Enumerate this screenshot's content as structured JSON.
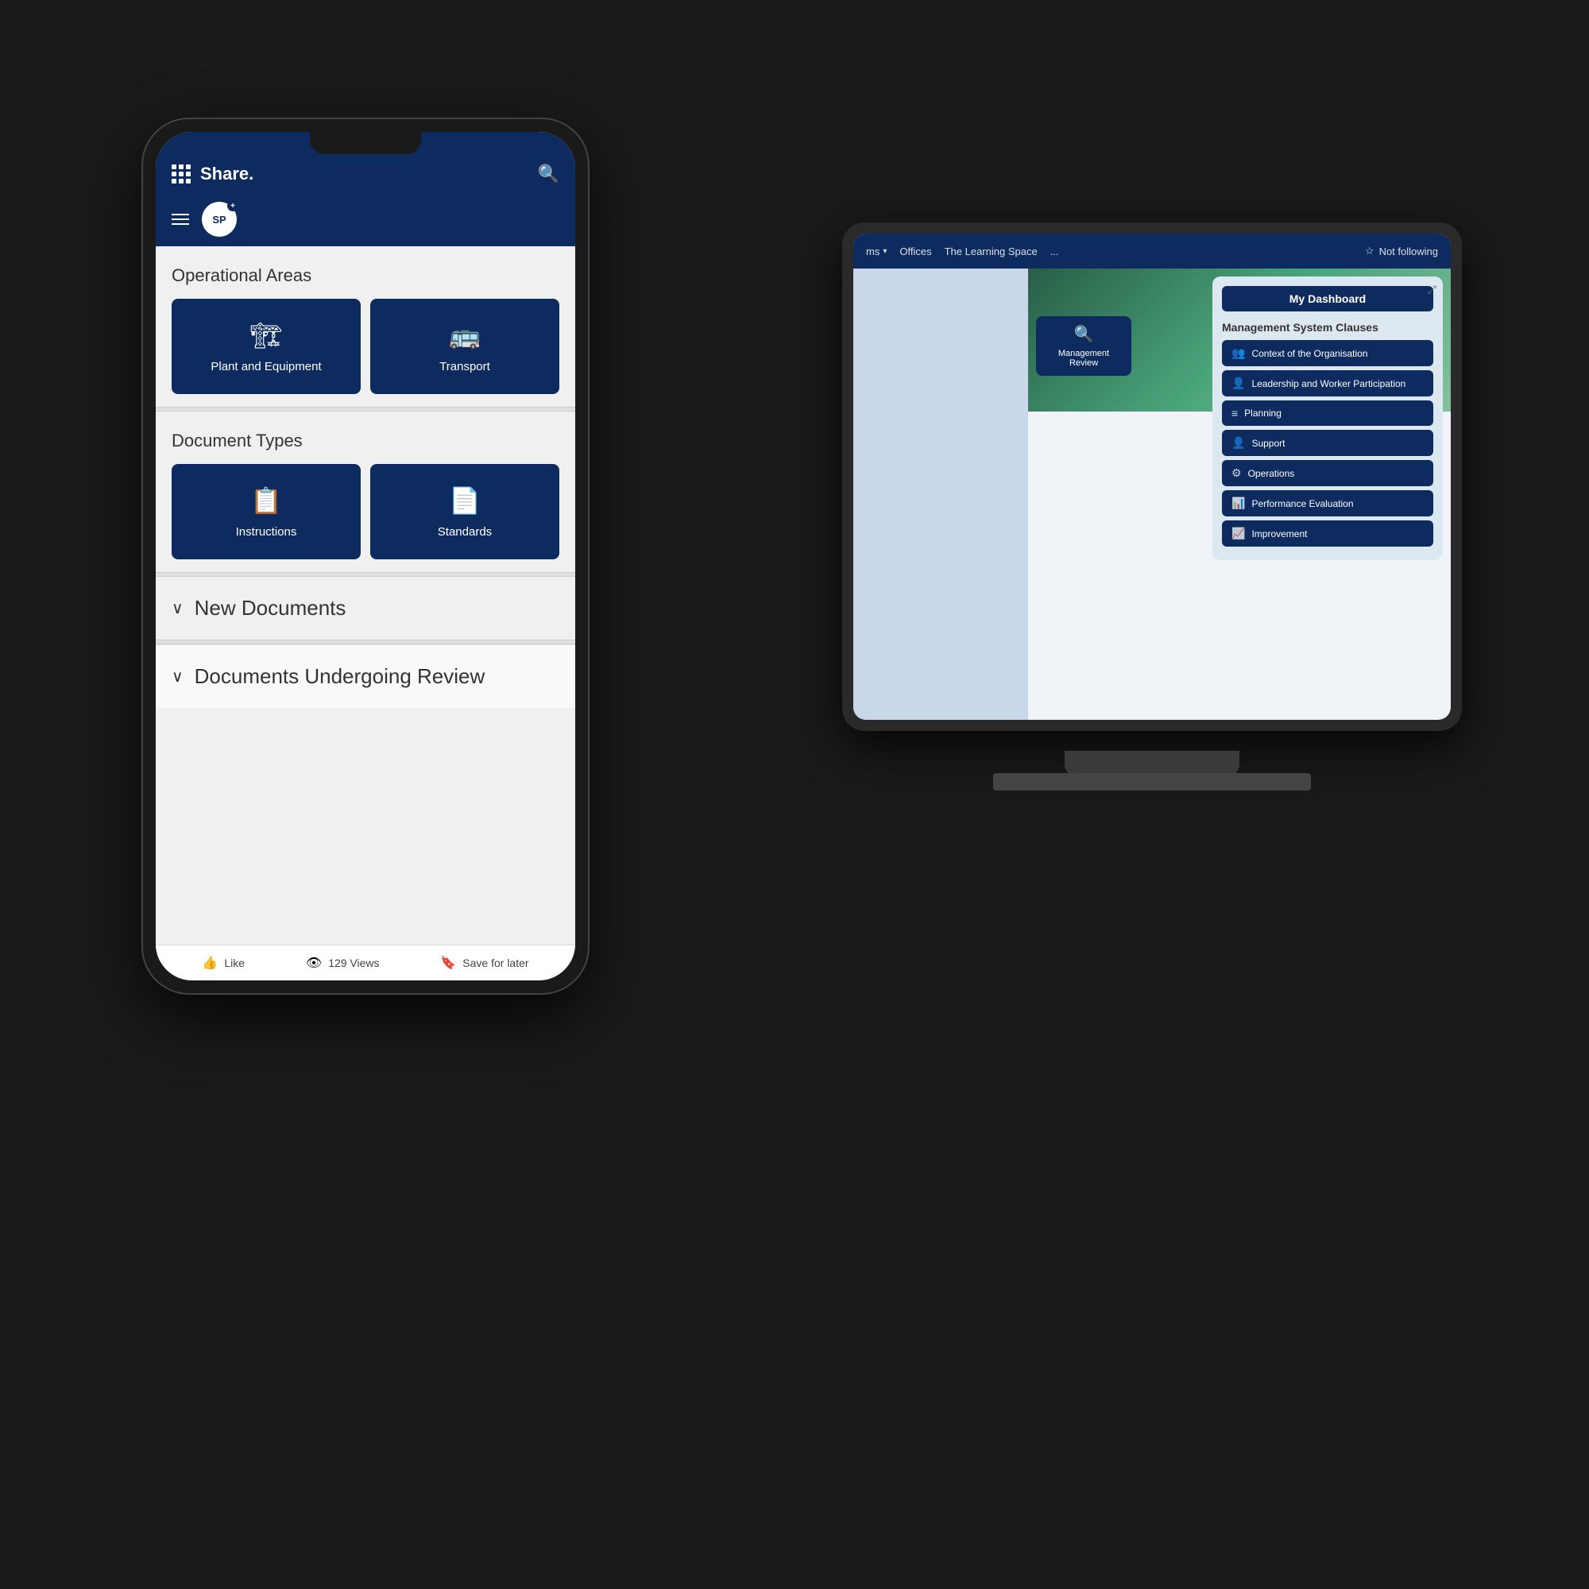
{
  "phone": {
    "title": "Share.",
    "logo_text": "SP",
    "plus_sign": "+",
    "operational_areas_title": "Operational Areas",
    "cards": [
      {
        "label": "Plant and Equipment",
        "icon": "🏗"
      },
      {
        "label": "Transport",
        "icon": "🚌"
      }
    ],
    "document_types_title": "Document Types",
    "doc_cards": [
      {
        "label": "Instructions",
        "icon": "📋"
      },
      {
        "label": "Standards",
        "icon": "📄"
      }
    ],
    "new_documents_label": "New Documents",
    "review_label": "Documents Undergoing Review",
    "footer": {
      "like": "Like",
      "views": "129 Views",
      "save": "Save for later"
    }
  },
  "tablet": {
    "nav_items": [
      "ms",
      "Offices",
      "The Learning Space",
      "..."
    ],
    "not_following": "Not following",
    "my_dashboard": "My Dashboard",
    "msc_title": "Management System Clauses",
    "msc_items": [
      {
        "label": "Context of the Organisation",
        "icon": "👥"
      },
      {
        "label": "Leadership and Worker Participation",
        "icon": "👤"
      },
      {
        "label": "Planning",
        "icon": "≡"
      },
      {
        "label": "Support",
        "icon": "👤"
      },
      {
        "label": "Operations",
        "icon": "⚙"
      },
      {
        "label": "Performance Evaluation",
        "icon": "📊"
      },
      {
        "label": "Improvement",
        "icon": "📈"
      }
    ],
    "small_card": {
      "label": "Management Review",
      "icon": "🔍"
    }
  }
}
